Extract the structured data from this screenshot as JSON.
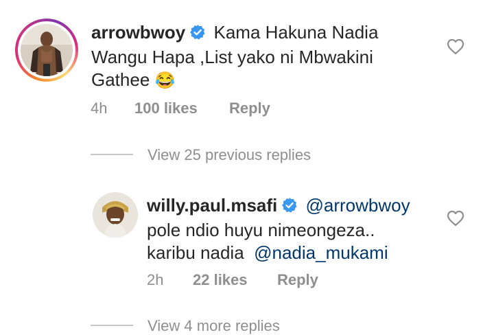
{
  "comments": [
    {
      "username": "arrowbwoy",
      "avatar_icon": "user-avatar-image",
      "verified_icon": "verified-badge-icon",
      "text_line1": "Kama Hakuna Nadia",
      "text_line2": "Wangu Hapa ,List yako ni Mbwakini",
      "text_line3": "Gathee",
      "emoji": "😂",
      "time": "4h",
      "likes": "100 likes",
      "reply_label": "Reply"
    },
    {
      "username": "willy.paul.msafi",
      "avatar_icon": "user-avatar-image",
      "verified_icon": "verified-badge-icon",
      "mention": "@arrowbwoy",
      "text_line2": "pole ndio huyu nimeongeza..",
      "text_line3_prefix": "karibu nadia",
      "mention2": "@nadia_mukami",
      "time": "2h",
      "likes": "22 likes",
      "reply_label": "Reply"
    }
  ],
  "view_previous": "View 25 previous replies",
  "view_more": "View 4 more replies",
  "colors": {
    "text": "#262626",
    "meta": "#8e8e8e",
    "mention": "#00376b",
    "verified": "#3897f0"
  }
}
